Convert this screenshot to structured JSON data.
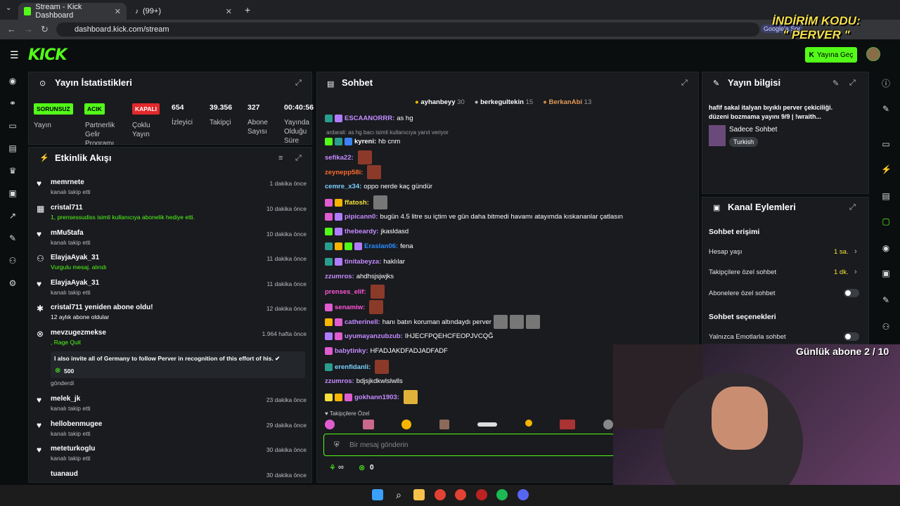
{
  "browser": {
    "tabs": [
      {
        "label": "Stream - Kick Dashboard"
      },
      {
        "label": "(99+)"
      }
    ],
    "url": "dashboard.kick.com/stream",
    "google_chip": "Google'a Sor"
  },
  "overlay": {
    "line1": "İNDİRİM KODU:",
    "line2": "\" PERVER \""
  },
  "header": {
    "go_live": "Yayına Geç"
  },
  "stats": {
    "title": "Yayın İstatistikleri",
    "items": [
      {
        "badge": "SORUNSUZ",
        "label": "Yayın",
        "color": "#53fc18"
      },
      {
        "badge": "ACIK",
        "label": "Partnerlik Gelir Programı",
        "color": "#53fc18"
      },
      {
        "badge": "KAPALI",
        "label": "Çoklu Yayın",
        "color": "#e2282c"
      }
    ],
    "numbers": [
      {
        "value": "654",
        "label": "İzleyici"
      },
      {
        "value": "39.356",
        "label": "Takipçi"
      },
      {
        "value": "327",
        "label": "Abone Sayısı"
      },
      {
        "value": "00:40:56",
        "label": "Yayında Olduğu Süre"
      }
    ]
  },
  "activity": {
    "title": "Etkinlik Akışı",
    "items": [
      {
        "name": "memrnete",
        "sub": "kanalı takip etti",
        "time": "1 dakika önce"
      },
      {
        "name": "cristal711",
        "sub": "1, prensessudiss isimli kullanıcıya abonelik hediye etti.",
        "time": "10 dakika önce"
      },
      {
        "name": "mMu5tafa",
        "sub": "kanalı takip etti",
        "time": "10 dakika önce"
      },
      {
        "name": "ElayjaAyak_31",
        "sub": "Vurgulu mesaj. alındı",
        "time": "11 dakika önce"
      },
      {
        "name": "ElayjaAyak_31",
        "sub": "kanalı takip etti",
        "time": "11 dakika önce"
      },
      {
        "name": "cristal711 yeniden abone oldu!",
        "sub": "12 aylık abone oldular",
        "time": "12 dakika önce"
      },
      {
        "name": "mevzugezmekse",
        "sub": ", Rage Quit",
        "time": "1.964 hafta önce"
      },
      {
        "name": "melek_jk",
        "sub": "kanalı takip etti",
        "time": "23 dakika önce"
      },
      {
        "name": "hellobenmugee",
        "sub": "kanalı takip etti",
        "time": "29 dakika önce"
      },
      {
        "name": "meteturkoglu",
        "sub": "kanalı takip etti",
        "time": "30 dakika önce"
      },
      {
        "name": "tuanaud",
        "sub": "",
        "time": "30 dakika önce"
      }
    ],
    "quote": "I also invite all of Germany to follow Perver in recognition of this effort of his. ✔",
    "quote_amount": "500",
    "quote_tail": "gönderdi"
  },
  "chat": {
    "title": "Sohbet",
    "top_gifters": [
      {
        "name": "ayhanbeyy",
        "count": "30"
      },
      {
        "name": "berkegultekin",
        "count": "15"
      },
      {
        "name": "BerkanAbi",
        "count": "13"
      }
    ],
    "reply_hint": "ardarali: as hg bacı isimli kullanıcıya yanıt veriyor",
    "messages": [
      {
        "user": "ESCAANORRR:",
        "text": "as hg",
        "color": "#c58cff"
      },
      {
        "user": "kyreni:",
        "text": "hb cnm",
        "color": "#ffffff"
      },
      {
        "user": "sefika22:",
        "text": "",
        "color": "#c58cff"
      },
      {
        "user": "zeynepp58i:",
        "text": "",
        "color": "#ff6a2a"
      },
      {
        "user": "cemre_x34:",
        "text": "oppo nerde kaç gündür",
        "color": "#7cd1ff"
      },
      {
        "user": "ffatosh:",
        "text": "",
        "color": "#f7e13a"
      },
      {
        "user": "pipicann0:",
        "text": "bugün 4.5 litre su içtim ve gün daha bitmedi havamı atayımda kıskananlar çatlasın",
        "color": "#c58cff"
      },
      {
        "user": "thebeardy:",
        "text": "jkasldasd",
        "color": "#c58cff"
      },
      {
        "user": "Eraslan06:",
        "text": "fena",
        "color": "#2a8cff"
      },
      {
        "user": "tinitabeyza:",
        "text": "haklılar",
        "color": "#c58cff"
      },
      {
        "user": "zzumros:",
        "text": "ahdhsjsjwjks",
        "color": "#c58cff"
      },
      {
        "user": "prenses_elif:",
        "text": "",
        "color": "#ff54d5"
      },
      {
        "user": "senamiw:",
        "text": "",
        "color": "#ff54d5"
      },
      {
        "user": "catherinell:",
        "text": "hanı batın koruman altındaydı perver",
        "color": "#c58cff"
      },
      {
        "user": "uyumayanzubzub:",
        "text": "IHJECFPQEHCFEOPJVCQĞ",
        "color": "#c58cff"
      },
      {
        "user": "babytinky:",
        "text": "HFADJAKDFADJADFADF",
        "color": "#c58cff"
      },
      {
        "user": "erenfidanli:",
        "text": "",
        "color": "#7cd1ff"
      },
      {
        "user": "zzumros:",
        "text": "bdjsjkdkwlslwlls",
        "color": "#c58cff"
      },
      {
        "user": "gokhann1903:",
        "text": "",
        "color": "#c58cff"
      }
    ],
    "followers_only": "Takipçilere Özel",
    "input_placeholder": "Bir mesaj gönderin",
    "points": "0"
  },
  "stream_info": {
    "title": "Yayın bilgisi",
    "description": "hafif sakal italyan bıyıklı perver çekiciliği. düzeni bozmama yayını 9/9 | !wraith...",
    "category": "Sadece Sohbet",
    "language": "Turkish"
  },
  "channel_actions": {
    "title": "Kanal Eylemleri",
    "access_title": "Sohbet erişimi",
    "rows": [
      {
        "label": "Hesap yaşı",
        "value": "1 sa."
      },
      {
        "label": "Takipçilere özel sohbet",
        "value": "1 dk."
      },
      {
        "label": "Abonelere özel sohbet",
        "value": ""
      }
    ],
    "options_title": "Sohbet seçenekleri",
    "emote_only": "Yalnızca Emotlarla sohbet"
  },
  "webcam": {
    "sub_goal": "Günlük abone 2 / 10"
  }
}
